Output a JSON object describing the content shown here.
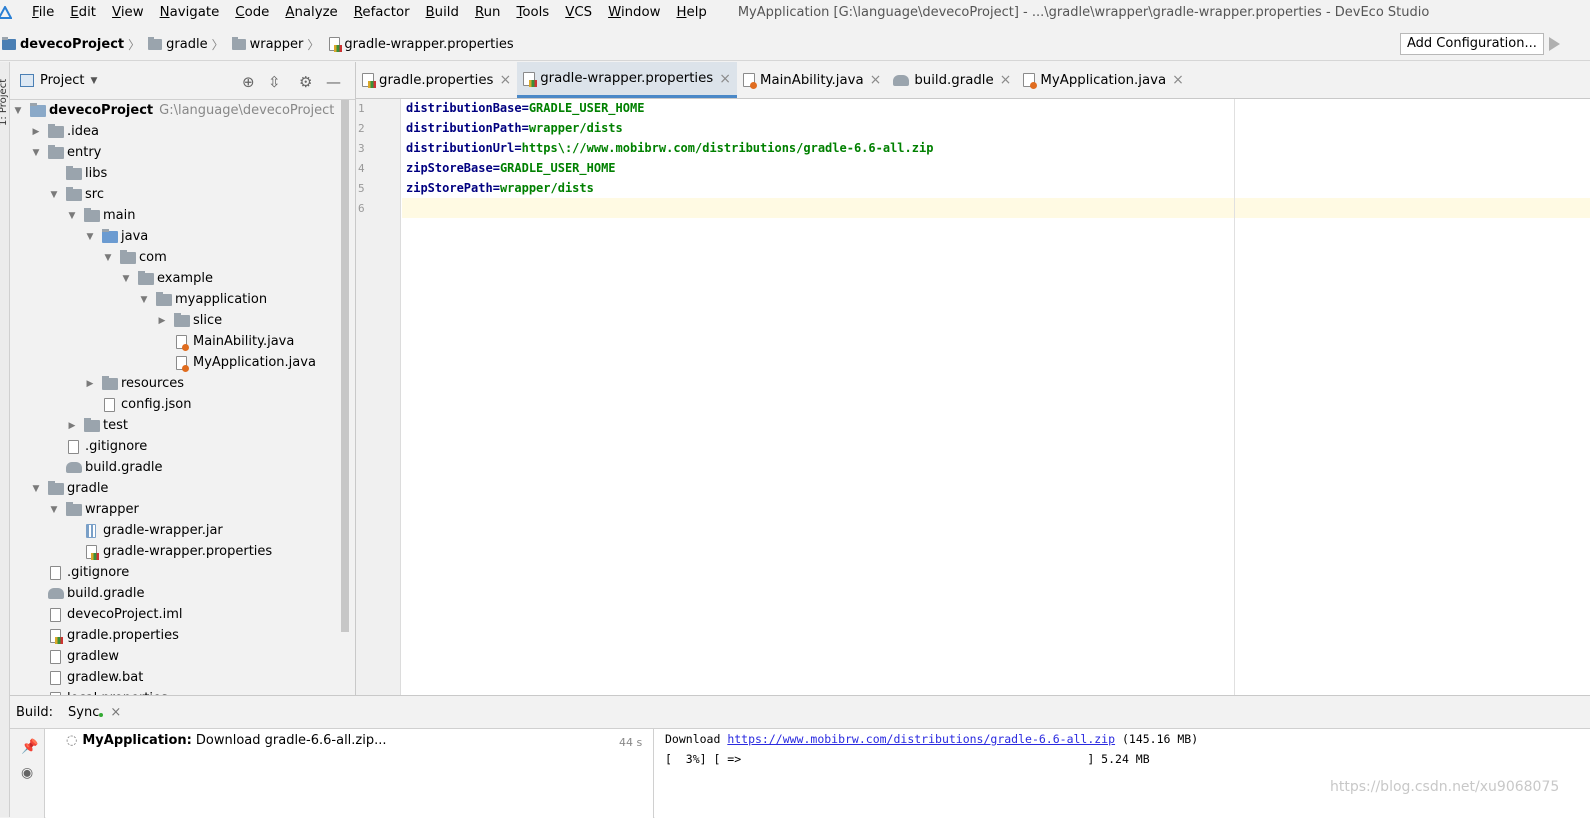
{
  "app": {
    "menu": [
      "File",
      "Edit",
      "View",
      "Navigate",
      "Code",
      "Analyze",
      "Refactor",
      "Build",
      "Run",
      "Tools",
      "VCS",
      "Window",
      "Help"
    ],
    "window_title": "MyApplication [G:\\language\\devecoProject] - ...\\gradle\\wrapper\\gradle-wrapper.properties - DevEco Studio"
  },
  "navbar": {
    "breadcrumbs": [
      "devecoProject",
      "gradle",
      "wrapper",
      "gradle-wrapper.properties"
    ],
    "add_configuration": "Add Configuration..."
  },
  "left_strip": {
    "label": "1: Project"
  },
  "project_panel": {
    "title": "Project",
    "tree": [
      {
        "label": "devecoProject",
        "path": "G:\\language\\devecoProject"
      },
      {
        "label": ".idea"
      },
      {
        "label": "entry"
      },
      {
        "label": "libs"
      },
      {
        "label": "src"
      },
      {
        "label": "main"
      },
      {
        "label": "java"
      },
      {
        "label": "com"
      },
      {
        "label": "example"
      },
      {
        "label": "myapplication"
      },
      {
        "label": "slice"
      },
      {
        "label": "MainAbility.java"
      },
      {
        "label": "MyApplication.java"
      },
      {
        "label": "resources"
      },
      {
        "label": "config.json"
      },
      {
        "label": "test"
      },
      {
        "label": ".gitignore"
      },
      {
        "label": "build.gradle"
      },
      {
        "label": "gradle"
      },
      {
        "label": "wrapper"
      },
      {
        "label": "gradle-wrapper.jar"
      },
      {
        "label": "gradle-wrapper.properties"
      },
      {
        "label": ".gitignore"
      },
      {
        "label": "build.gradle"
      },
      {
        "label": "devecoProject.iml"
      },
      {
        "label": "gradle.properties"
      },
      {
        "label": "gradlew"
      },
      {
        "label": "gradlew.bat"
      },
      {
        "label": "local.properties"
      }
    ]
  },
  "tabs": [
    {
      "label": "gradle.properties",
      "close": "×"
    },
    {
      "label": "gradle-wrapper.properties",
      "close": "×"
    },
    {
      "label": "MainAbility.java",
      "close": "×"
    },
    {
      "label": "build.gradle",
      "close": "×"
    },
    {
      "label": "MyApplication.java",
      "close": "×"
    }
  ],
  "editor": {
    "lines": [
      {
        "num": "1",
        "key": "distributionBase",
        "val": "GRADLE_USER_HOME"
      },
      {
        "num": "2",
        "key": "distributionPath",
        "val": "wrapper/dists"
      },
      {
        "num": "3",
        "key": "distributionUrl",
        "val": "https\\://www.mobibrw.com/distributions/gradle-6.6-all.zip"
      },
      {
        "num": "4",
        "key": "zipStoreBase",
        "val": "GRADLE_USER_HOME"
      },
      {
        "num": "5",
        "key": "zipStorePath",
        "val": "wrapper/dists"
      },
      {
        "num": "6",
        "key": "",
        "val": ""
      }
    ]
  },
  "build": {
    "label": "Build:",
    "tab": "Sync",
    "close": "×",
    "task_name": "MyApplication:",
    "task_text": "Download gradle-6.6-all.zip...",
    "task_time": "44 s",
    "out_line1_prefix": "Download ",
    "out_link": "https://www.mobibrw.com/distributions/gradle-6.6-all.zip",
    "out_line1_suffix": " (145.16 MB)",
    "out_line2": "[  3%] [ =>                                                  ] 5.24 MB"
  },
  "watermark": "https://blog.csdn.net/xu9068075"
}
